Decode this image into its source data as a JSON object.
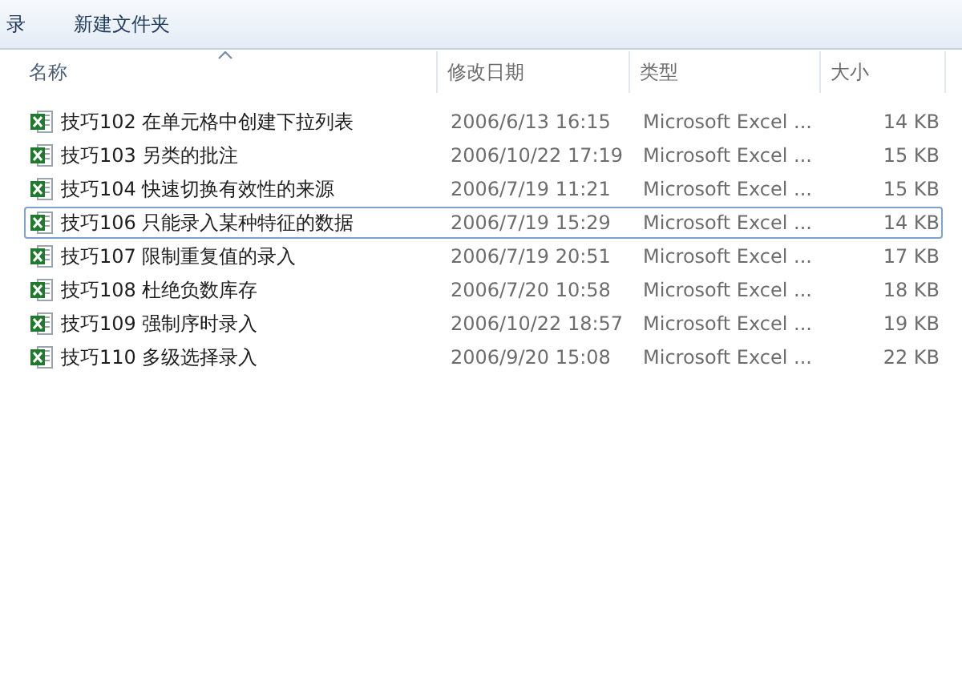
{
  "toolbar": {
    "items": [
      "录",
      "新建文件夹"
    ]
  },
  "table": {
    "columns": [
      {
        "label": "名称",
        "sorted": true
      },
      {
        "label": "修改日期",
        "sorted": false
      },
      {
        "label": "类型",
        "sorted": false
      },
      {
        "label": "大小",
        "sorted": false
      }
    ],
    "rows": [
      {
        "name": "技巧102 在单元格中创建下拉列表",
        "date": "2006/6/13 16:15",
        "type": "Microsoft Excel ...",
        "size": "14 KB",
        "focused": false
      },
      {
        "name": "技巧103 另类的批注",
        "date": "2006/10/22 17:19",
        "type": "Microsoft Excel ...",
        "size": "15 KB",
        "focused": false
      },
      {
        "name": "技巧104 快速切换有效性的来源",
        "date": "2006/7/19 11:21",
        "type": "Microsoft Excel ...",
        "size": "15 KB",
        "focused": false
      },
      {
        "name": "技巧106 只能录入某种特征的数据",
        "date": "2006/7/19 15:29",
        "type": "Microsoft Excel ...",
        "size": "14 KB",
        "focused": true
      },
      {
        "name": "技巧107 限制重复值的录入",
        "date": "2006/7/19 20:51",
        "type": "Microsoft Excel ...",
        "size": "17 KB",
        "focused": false
      },
      {
        "name": "技巧108 杜绝负数库存",
        "date": "2006/7/20 10:58",
        "type": "Microsoft Excel ...",
        "size": "18 KB",
        "focused": false
      },
      {
        "name": "技巧109 强制序时录入",
        "date": "2006/10/22 18:57",
        "type": "Microsoft Excel ...",
        "size": "19 KB",
        "focused": false
      },
      {
        "name": "技巧110 多级选择录入",
        "date": "2006/9/20 15:08",
        "type": "Microsoft Excel ...",
        "size": "22 KB",
        "focused": false
      }
    ]
  }
}
